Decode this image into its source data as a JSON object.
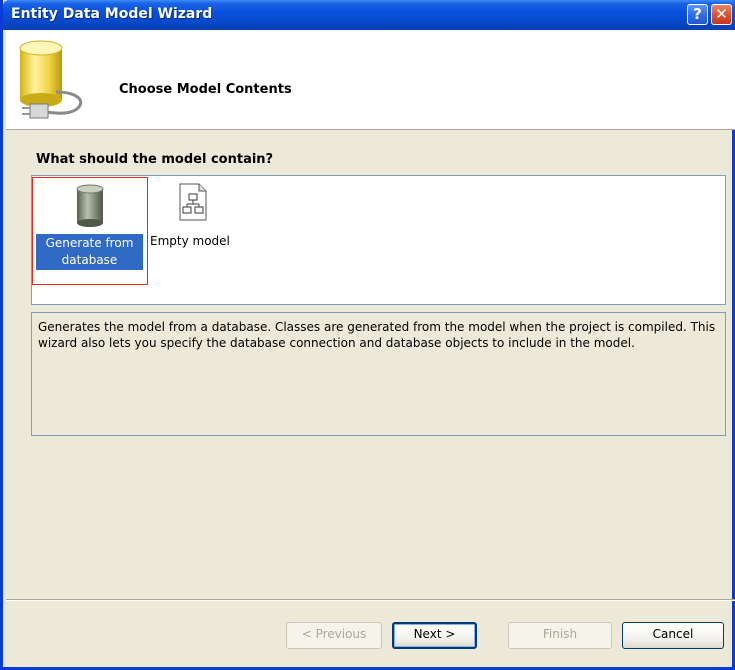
{
  "window": {
    "title": "Entity Data Model Wizard"
  },
  "titlebar": {
    "help_label": "?",
    "close_label": "✕"
  },
  "header": {
    "title": "Choose Model Contents"
  },
  "main": {
    "question": "What should the model contain?",
    "choices": [
      {
        "label": "Generate from database",
        "icon": "database-icon",
        "selected": true
      },
      {
        "label": "Empty model",
        "icon": "empty-model-icon",
        "selected": false
      }
    ],
    "description": "Generates the model from a database. Classes are generated from the model when the project is compiled. This wizard also lets you specify the database connection and database objects to include in the model."
  },
  "buttons": {
    "previous": "< Previous",
    "next": "Next >",
    "finish": "Finish",
    "cancel": "Cancel"
  },
  "colors": {
    "titlebar": "#0851dc",
    "selection": "#316ac5",
    "highlight_border": "#e52a22",
    "dialog_bg": "#ece9d8"
  }
}
